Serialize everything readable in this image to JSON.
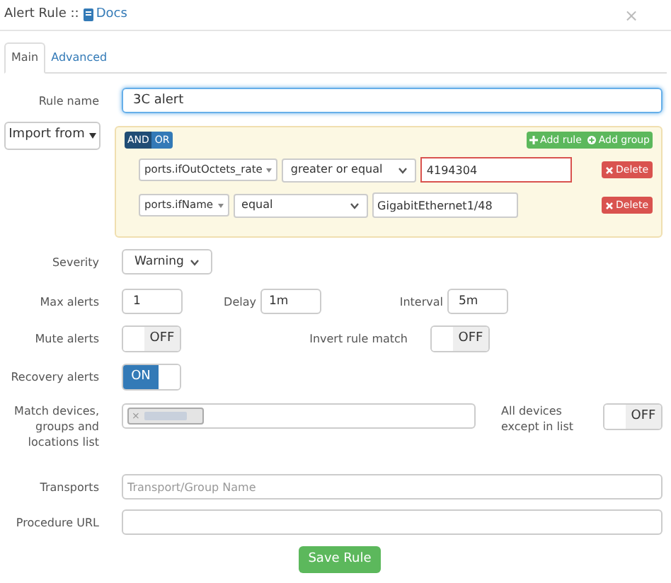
{
  "window": {
    "title": "Alert Rule ::",
    "docs_link": "Docs",
    "close": "×"
  },
  "tabs": [
    {
      "label": "Main",
      "selected": true
    },
    {
      "label": "Advanced",
      "selected": false
    }
  ],
  "rule_name": {
    "label": "Rule name",
    "value": "3C alert"
  },
  "import_button": "Import from",
  "builder": {
    "conditions": [
      {
        "label": "AND",
        "selected": true
      },
      {
        "label": "OR",
        "selected": false
      }
    ],
    "add_rule": "Add rule",
    "add_group": "Add group",
    "rules": [
      {
        "field": "ports.ifOutOctets_rate",
        "operator": "greater or equal",
        "value": "4194304",
        "highlighted": true,
        "delete": "Delete"
      },
      {
        "field": "ports.ifName",
        "operator": "equal",
        "value": "GigabitEthernet1/48",
        "highlighted": false,
        "delete": "Delete"
      }
    ]
  },
  "severity": {
    "label": "Severity",
    "value": "Warning"
  },
  "max_alerts": {
    "label": "Max alerts",
    "value": "1"
  },
  "delay": {
    "label": "Delay",
    "value": "1m"
  },
  "interval": {
    "label": "Interval",
    "value": "5m"
  },
  "mute_alerts": {
    "label": "Mute alerts",
    "on": false,
    "text": "OFF"
  },
  "invert_rule_match": {
    "label": "Invert rule match",
    "on": false,
    "text": "OFF"
  },
  "recovery_alerts": {
    "label": "Recovery alerts",
    "on": true,
    "text": "ON"
  },
  "match_devices": {
    "label": "Match devices, groups and locations list",
    "chip_remove": "×"
  },
  "all_devices_except": {
    "label": "All devices except in list",
    "on": false,
    "text": "OFF"
  },
  "transports": {
    "label": "Transports",
    "placeholder": "Transport/Group Name"
  },
  "procedure_url": {
    "label": "Procedure URL"
  },
  "save_button": "Save Rule"
}
